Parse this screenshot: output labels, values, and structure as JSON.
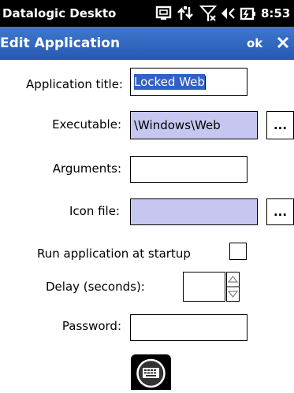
{
  "status_bar": {
    "title": "Datalogic Deskto",
    "time": "8:53",
    "icons": [
      "desktop-icon",
      "connectivity-icon",
      "no-signal-icon",
      "volume-muted-icon",
      "battery-charging-icon"
    ]
  },
  "title_bar": {
    "title": "Edit Application",
    "ok_label": "ok",
    "close_label": "✕"
  },
  "form": {
    "application_title": {
      "label": "Application title:",
      "value": "Locked Web"
    },
    "executable": {
      "label": "Executable:",
      "value": "\\Windows\\Web",
      "browse_label": "..."
    },
    "arguments": {
      "label": "Arguments:",
      "value": ""
    },
    "icon_file": {
      "label": "Icon file:",
      "value": "",
      "browse_label": "..."
    },
    "run_at_startup": {
      "label": "Run application at startup",
      "checked": false
    },
    "delay": {
      "label": "Delay (seconds):",
      "value": ""
    },
    "password": {
      "label": "Password:",
      "value": ""
    }
  },
  "colors": {
    "title_bar": "#2f66c0",
    "selection": "#3161c6",
    "disabled_field": "#c6c6f0"
  },
  "soft_keyboard_icon": "keyboard-icon"
}
